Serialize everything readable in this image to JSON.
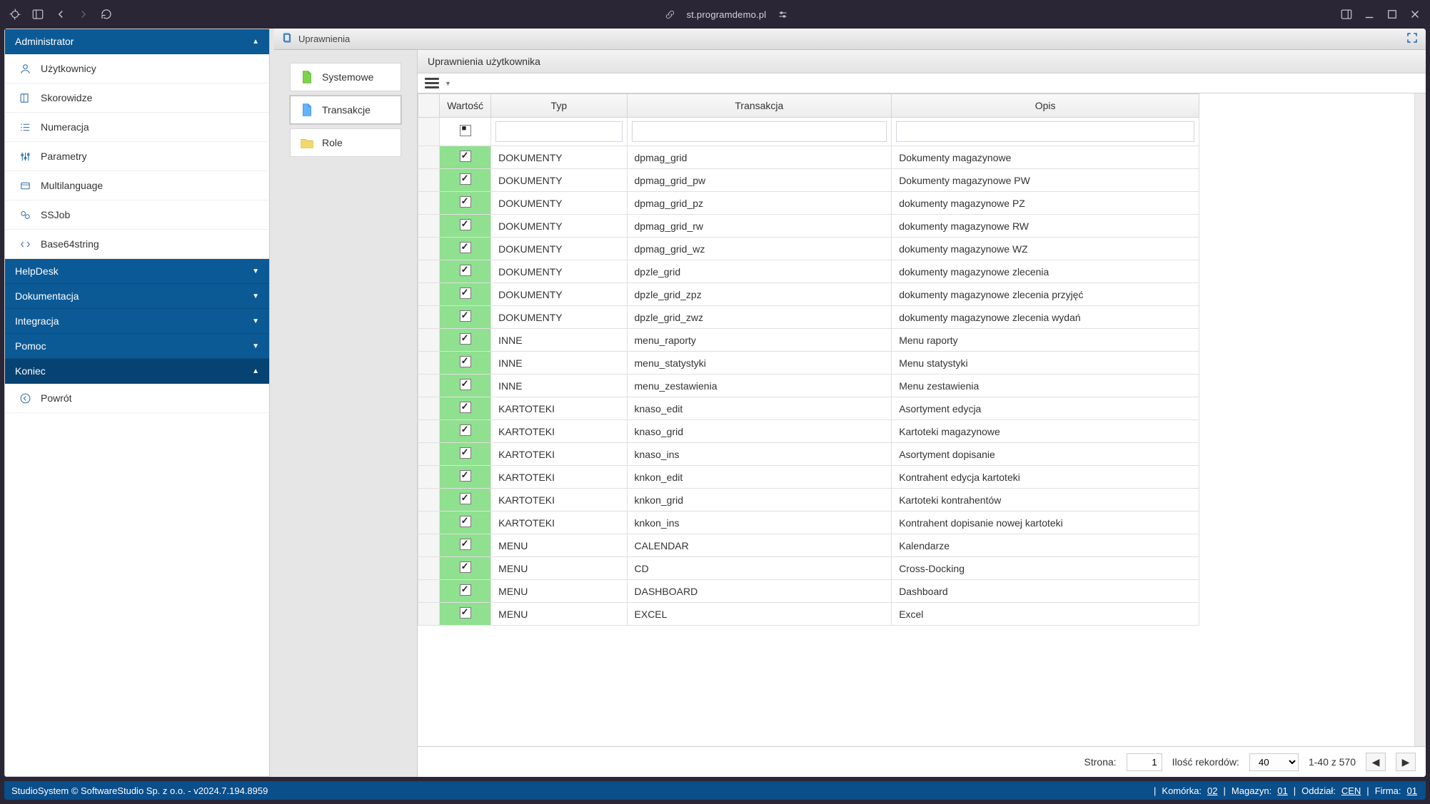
{
  "browser": {
    "url": "st.programdemo.pl"
  },
  "sidebar": {
    "sections": [
      {
        "title": "Administrator",
        "expanded": true,
        "items": [
          {
            "label": "Użytkownicy"
          },
          {
            "label": "Skorowidze"
          },
          {
            "label": "Numeracja"
          },
          {
            "label": "Parametry"
          },
          {
            "label": "Multilanguage"
          },
          {
            "label": "SSJob"
          },
          {
            "label": "Base64string"
          }
        ]
      },
      {
        "title": "HelpDesk",
        "expanded": false
      },
      {
        "title": "Dokumentacja",
        "expanded": false
      },
      {
        "title": "Integracja",
        "expanded": false
      },
      {
        "title": "Pomoc",
        "expanded": false
      },
      {
        "title": "Koniec",
        "expanded": true,
        "items": [
          {
            "label": "Powrót"
          }
        ]
      }
    ]
  },
  "content": {
    "tab_title": "Uprawnienia",
    "mini_tabs": [
      {
        "label": "Systemowe",
        "color": "#7fd24b"
      },
      {
        "label": "Transakcje",
        "color": "#66b4ff"
      },
      {
        "label": "Role",
        "color": "#f3d86b"
      }
    ],
    "panel_title": "Uprawnienia użytkownika",
    "columns": {
      "value": "Wartość",
      "type": "Typ",
      "transaction": "Transakcja",
      "desc": "Opis"
    },
    "rows": [
      {
        "checked": true,
        "type": "DOKUMENTY",
        "trans": "dpmag_grid",
        "desc": "Dokumenty magazynowe"
      },
      {
        "checked": true,
        "type": "DOKUMENTY",
        "trans": "dpmag_grid_pw",
        "desc": "Dokumenty magazynowe PW"
      },
      {
        "checked": true,
        "type": "DOKUMENTY",
        "trans": "dpmag_grid_pz",
        "desc": "dokumenty magazynowe PZ"
      },
      {
        "checked": true,
        "type": "DOKUMENTY",
        "trans": "dpmag_grid_rw",
        "desc": "dokumenty magazynowe RW"
      },
      {
        "checked": true,
        "type": "DOKUMENTY",
        "trans": "dpmag_grid_wz",
        "desc": "dokumenty magazynowe WZ"
      },
      {
        "checked": true,
        "type": "DOKUMENTY",
        "trans": "dpzle_grid",
        "desc": "dokumenty magazynowe zlecenia"
      },
      {
        "checked": true,
        "type": "DOKUMENTY",
        "trans": "dpzle_grid_zpz",
        "desc": "dokumenty magazynowe zlecenia przyjęć"
      },
      {
        "checked": true,
        "type": "DOKUMENTY",
        "trans": "dpzle_grid_zwz",
        "desc": "dokumenty magazynowe zlecenia wydań"
      },
      {
        "checked": true,
        "type": "INNE",
        "trans": "menu_raporty",
        "desc": "Menu raporty"
      },
      {
        "checked": true,
        "type": "INNE",
        "trans": "menu_statystyki",
        "desc": "Menu statystyki"
      },
      {
        "checked": true,
        "type": "INNE",
        "trans": "menu_zestawienia",
        "desc": "Menu zestawienia"
      },
      {
        "checked": true,
        "type": "KARTOTEKI",
        "trans": "knaso_edit",
        "desc": "Asortyment edycja"
      },
      {
        "checked": true,
        "type": "KARTOTEKI",
        "trans": "knaso_grid",
        "desc": "Kartoteki magazynowe"
      },
      {
        "checked": true,
        "type": "KARTOTEKI",
        "trans": "knaso_ins",
        "desc": "Asortyment dopisanie"
      },
      {
        "checked": true,
        "type": "KARTOTEKI",
        "trans": "knkon_edit",
        "desc": "Kontrahent edycja kartoteki"
      },
      {
        "checked": true,
        "type": "KARTOTEKI",
        "trans": "knkon_grid",
        "desc": "Kartoteki kontrahentów"
      },
      {
        "checked": true,
        "type": "KARTOTEKI",
        "trans": "knkon_ins",
        "desc": "Kontrahent dopisanie nowej kartoteki"
      },
      {
        "checked": true,
        "type": "MENU",
        "trans": "CALENDAR",
        "desc": "Kalendarze"
      },
      {
        "checked": true,
        "type": "MENU",
        "trans": "CD",
        "desc": "Cross-Docking"
      },
      {
        "checked": true,
        "type": "MENU",
        "trans": "DASHBOARD",
        "desc": "Dashboard"
      },
      {
        "checked": true,
        "type": "MENU",
        "trans": "EXCEL",
        "desc": "Excel"
      }
    ],
    "pager": {
      "page_label": "Strona:",
      "page_value": "1",
      "records_label": "Ilość rekordów:",
      "records_value": "40",
      "range": "1-40 z 570"
    }
  },
  "status": {
    "left": "StudioSystem © SoftwareStudio Sp. z o.o. - v2024.7.194.8959",
    "komorka_label": "Komórka:",
    "komorka": "02",
    "magazyn_label": "Magazyn:",
    "magazyn": "01",
    "oddzial_label": "Oddział:",
    "oddzial": "CEN",
    "firma_label": "Firma:",
    "firma": "01"
  }
}
